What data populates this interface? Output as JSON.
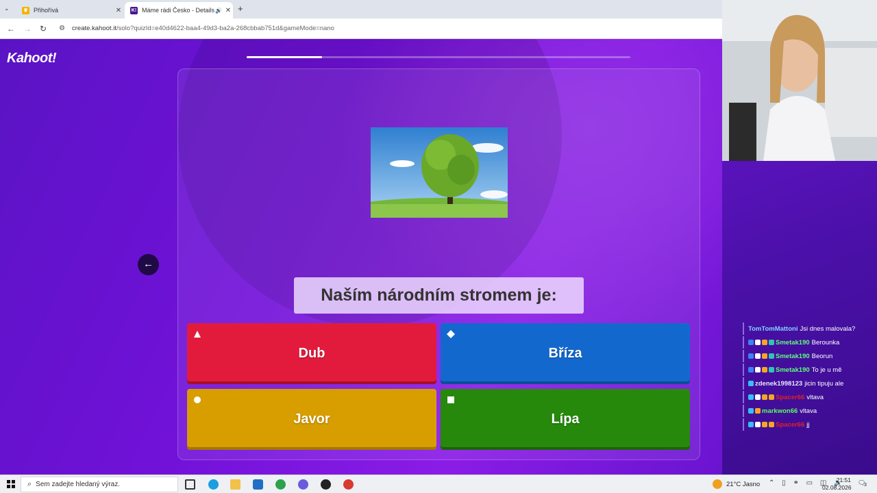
{
  "browser": {
    "tabs": [
      {
        "title": "Přihořívá",
        "favicon": "crown-icon"
      },
      {
        "title": "Máme rádi Česko - Details",
        "favicon": "kahoot-icon",
        "active": true
      }
    ],
    "url_host": "create.kahoot.it",
    "url_path": "/solo?quizId=e40d4622-baa4-49d3-ba2a-268cbbab751d&gameMode=nano"
  },
  "kahoot": {
    "logo": "Kahoot!",
    "progress": 0.196,
    "question": "Naším národním stromem je:",
    "back_arrow": "←",
    "answers": [
      {
        "label": "Dub",
        "shape": "triangle-icon",
        "color": "#e21b3c"
      },
      {
        "label": "Bříza",
        "shape": "diamond-icon",
        "color": "#1368ce"
      },
      {
        "label": "Javor",
        "shape": "circle-icon",
        "color": "#d89e00"
      },
      {
        "label": "Lípa",
        "shape": "square-icon",
        "color": "#26890c"
      }
    ]
  },
  "chat": [
    {
      "user": "TomTomMattoni",
      "message": "Jsi dnes malovala?",
      "color": "#7fd3ff",
      "badges": []
    },
    {
      "user": "Smetak190",
      "message": "Berounka",
      "color": "#5dff7a",
      "badges": [
        "#3b82f6",
        "#ffffff",
        "#f5a623",
        "#2ec4b6"
      ]
    },
    {
      "user": "Smetak190",
      "message": "Beorun",
      "color": "#5dff7a",
      "badges": [
        "#3b82f6",
        "#ffffff",
        "#f5a623",
        "#2ec4b6"
      ]
    },
    {
      "user": "Smetak190",
      "message": "To je u mě",
      "color": "#5dff7a",
      "badges": [
        "#3b82f6",
        "#ffffff",
        "#f5a623",
        "#2ec4b6"
      ]
    },
    {
      "user": "zdenek1998123",
      "message": "jicin tipuju ale",
      "color": "#e8e8ff",
      "badges": [
        "#38bdf8"
      ]
    },
    {
      "user": "Spacer66",
      "message": "vltava",
      "color": "#e0202c",
      "badges": [
        "#38bdf8",
        "#ffffff",
        "#f5a623",
        "#f5a623"
      ]
    },
    {
      "user": "markwon66",
      "message": "vltava",
      "color": "#59ff5d",
      "badges": [
        "#38bdf8",
        "#f5a623"
      ]
    },
    {
      "user": "Spacer66",
      "message": "jj",
      "color": "#e0202c",
      "badges": [
        "#38bdf8",
        "#ffffff",
        "#f5a623",
        "#f5a623"
      ]
    }
  ],
  "taskbar": {
    "search_placeholder": "Sem zadejte hledaný výraz.",
    "weather": "21°C  Jasno",
    "time": "21:51",
    "date": "02.08.2026",
    "notifications": "3"
  }
}
